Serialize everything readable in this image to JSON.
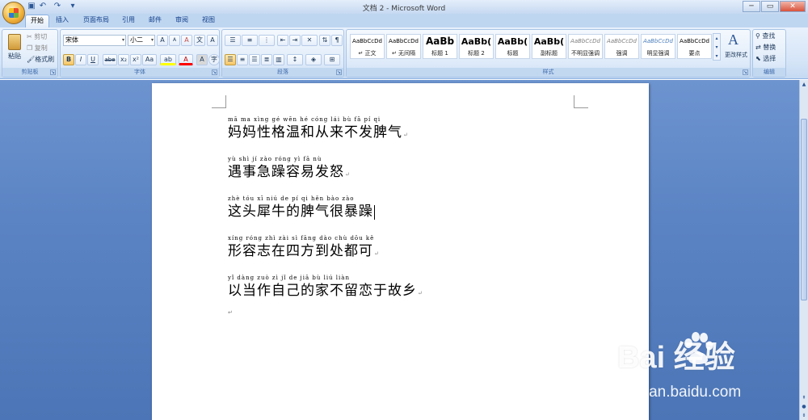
{
  "window": {
    "title": "文档 2 - Microsoft Word",
    "controls": {
      "minimize": "─",
      "maximize": "▭",
      "close": "✕"
    }
  },
  "quick_access": {
    "save_icon": "save-icon",
    "undo_icon": "undo-icon",
    "redo_icon": "redo-icon",
    "customize_icon": "chevron-down-icon"
  },
  "tabs": [
    {
      "label": "开始",
      "active": true
    },
    {
      "label": "插入"
    },
    {
      "label": "页面布局"
    },
    {
      "label": "引用"
    },
    {
      "label": "邮件"
    },
    {
      "label": "审阅"
    },
    {
      "label": "视图"
    }
  ],
  "clipboard": {
    "group_label": "剪贴板",
    "paste_label": "粘贴",
    "cut_label": "剪切",
    "copy_label": "复制",
    "format_painter_label": "格式刷"
  },
  "font": {
    "group_label": "字体",
    "font_name": "宋体",
    "font_size": "小二",
    "bold": "B",
    "italic": "I",
    "underline": "U",
    "strikethrough": "abe",
    "subscript": "x₂",
    "superscript": "x²",
    "change_case": "Aa",
    "grow": "A",
    "shrink": "A",
    "clear": "A",
    "phonetic": "文",
    "border": "A",
    "shading": "A",
    "enclose": "字",
    "highlight": "ab",
    "font_color": "A"
  },
  "paragraph": {
    "group_label": "段落"
  },
  "styles": {
    "group_label": "样式",
    "items": [
      {
        "sample": "AaBbCcDd",
        "name": "↵ 正文",
        "kind": "normal"
      },
      {
        "sample": "AaBbCcDd",
        "name": "↵ 无间隔",
        "kind": "normal"
      },
      {
        "sample": "AaBb",
        "name": "标题 1",
        "kind": "big"
      },
      {
        "sample": "AaBb(",
        "name": "标题 2",
        "kind": "mid"
      },
      {
        "sample": "AaBb(",
        "name": "标题",
        "kind": "mid"
      },
      {
        "sample": "AaBb(",
        "name": "副标题",
        "kind": "mid"
      },
      {
        "sample": "AaBbCcDd",
        "name": "不明显强调",
        "kind": "it"
      },
      {
        "sample": "AaBbCcDd",
        "name": "强调",
        "kind": "it"
      },
      {
        "sample": "AaBbCcDd",
        "name": "明显强调",
        "kind": "blue"
      },
      {
        "sample": "AaBbCcDd",
        "name": "要点",
        "kind": "normal"
      }
    ],
    "change_styles_label": "更改样式"
  },
  "editing": {
    "group_label": "编辑",
    "find_label": "查找",
    "replace_label": "替换",
    "select_label": "选择"
  },
  "document": {
    "paragraphs": [
      {
        "pinyin": "mā ma xìng gé wēn hé cóng lái bù fā pí qi",
        "text": "妈妈性格温和从来不发脾气"
      },
      {
        "pinyin": "yù shì jí zào róng yì fā nù",
        "text": "遇事急躁容易发怒"
      },
      {
        "pinyin": "zhè tóu xī niú de pí qi hěn bào zào",
        "text": "这头犀牛的脾气很暴躁",
        "caret": true
      },
      {
        "pinyin": "xíng róng zhì zài sì fāng dào chù dōu kě",
        "text": "形容志在四方到处都可"
      },
      {
        "pinyin": "yǐ dàng zuò zì jǐ de jiā bù liú liàn",
        "text": "以当作自己的家不留恋于故乡"
      }
    ],
    "paragraph_mark": "↵"
  },
  "watermark": {
    "brand": "Bai  经验",
    "cn": "",
    "url": "jingyan.baidu.com"
  }
}
